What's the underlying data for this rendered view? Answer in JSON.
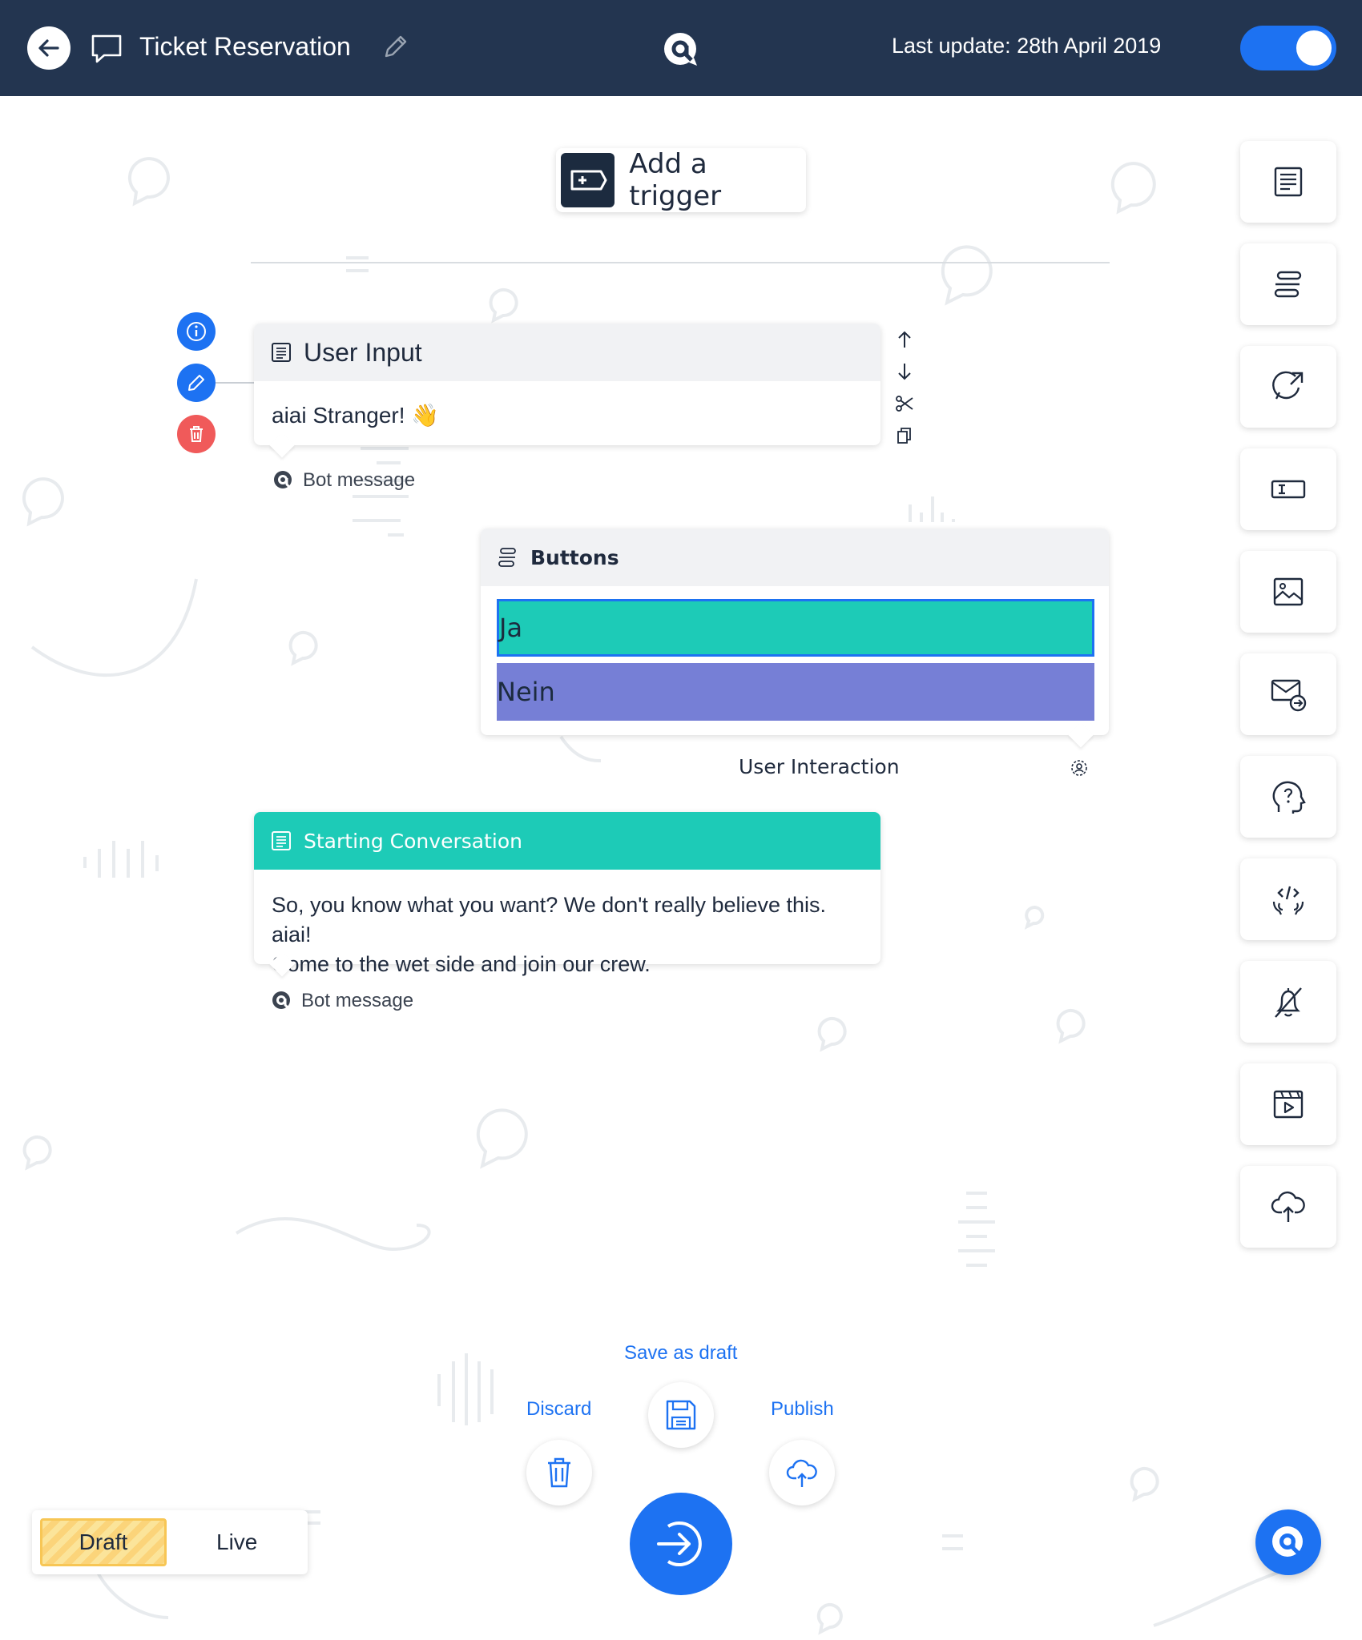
{
  "header": {
    "title": "Ticket Reservation",
    "last_update": "Last update: 28th April 2019",
    "live_toggle_on": true
  },
  "trigger": {
    "label": "Add a trigger"
  },
  "user_input_card": {
    "title": "User Input",
    "message": "aiai Stranger! 👋",
    "caption": "Bot message"
  },
  "buttons_card": {
    "title": "Buttons",
    "options": [
      {
        "label": "Ja",
        "color": "#1dcbb7",
        "selected": true
      },
      {
        "label": "Nein",
        "color": "#767fd6",
        "selected": false
      }
    ],
    "caption": "User Interaction"
  },
  "starting_card": {
    "title": "Starting Conversation",
    "message_line1": "So, you know what you want? We don't really believe this. aiai!",
    "message_line2": "Come to the wet side and join our crew.",
    "caption": "Bot message"
  },
  "toolbar": {
    "items": [
      "text-block-icon",
      "buttons-icon",
      "chat-reply-icon",
      "input-field-icon",
      "image-icon",
      "mail-forward-icon",
      "help-head-icon",
      "code-hands-icon",
      "notification-off-icon",
      "video-icon",
      "cloud-upload-icon"
    ]
  },
  "actions": {
    "save_draft": "Save as draft",
    "discard": "Discard",
    "publish": "Publish"
  },
  "mode": {
    "draft": "Draft",
    "live": "Live"
  },
  "colors": {
    "header_bg": "#233550",
    "accent_blue": "#1d72f2",
    "teal": "#1dcbb7",
    "purple": "#767fd6",
    "danger": "#f05a5a"
  }
}
